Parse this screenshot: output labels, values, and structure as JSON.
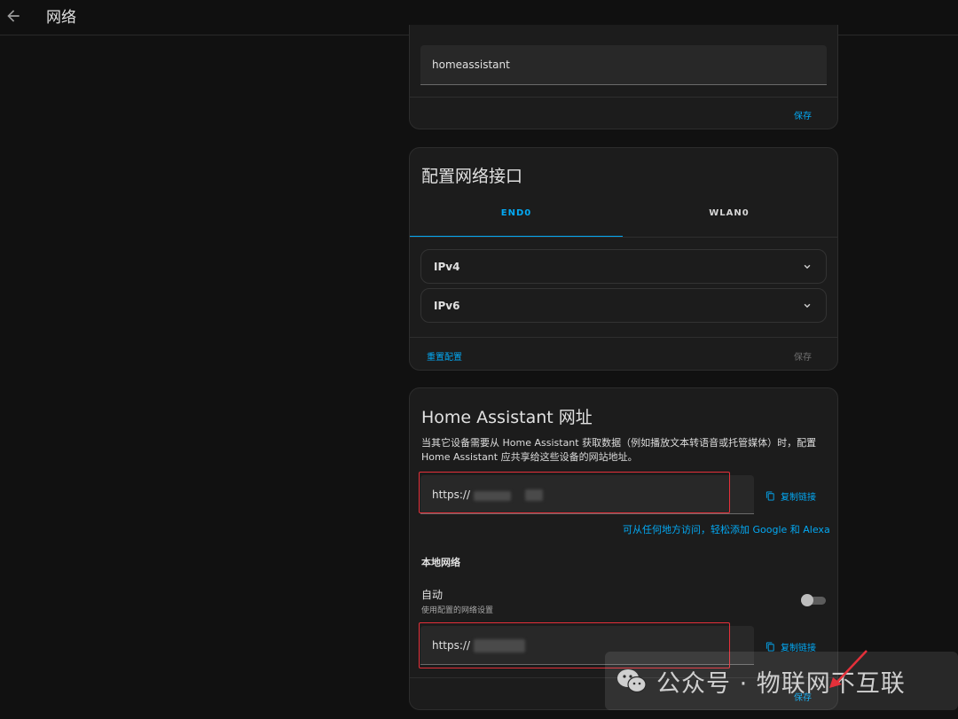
{
  "header": {
    "title": "网络"
  },
  "hostname_card": {
    "value": "homeassistant",
    "save_label": "保存"
  },
  "interface_card": {
    "title": "配置网络接口",
    "tabs": [
      {
        "label": "END0"
      },
      {
        "label": "WLAN0"
      }
    ],
    "sections": [
      {
        "label": "IPv4"
      },
      {
        "label": "IPv6"
      }
    ],
    "reset_label": "重置配置",
    "save_label": "保存"
  },
  "url_card": {
    "title": "Home Assistant 网址",
    "description": "当其它设备需要从 Home Assistant 获取数据（例如播放文本转语音或托管媒体）时，配置 Home Assistant 应共享给这些设备的网站地址。",
    "external_url": {
      "value": "https://",
      "copy_label": "复制链接"
    },
    "cloud_link": "可从任何地方访问，轻松添加 Google 和 Alexa",
    "local_section": "本地网络",
    "auto": {
      "title": "自动",
      "subtitle": "使用配置的网络设置",
      "enabled": false
    },
    "internal_url": {
      "value": "https://",
      "copy_label": "复制链接"
    },
    "save_label": "保存"
  },
  "watermark": {
    "text": "公众号 · 物联网不互联"
  },
  "colors": {
    "accent": "#03a9f4",
    "highlight": "#e5303a",
    "background": "#111111",
    "card": "#1c1c1c"
  }
}
